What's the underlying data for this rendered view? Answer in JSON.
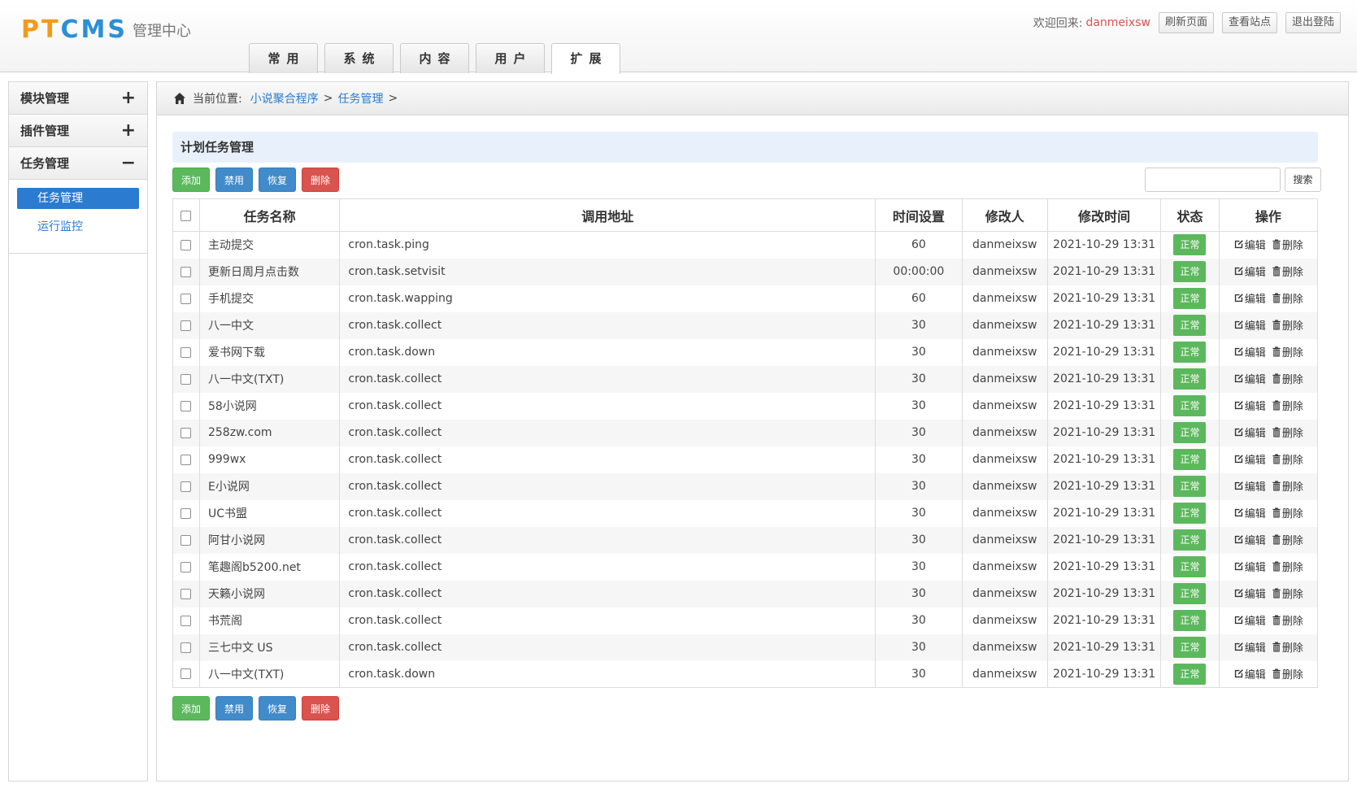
{
  "header": {
    "logo_text": "PTCMS",
    "logo_sub": "管理中心",
    "welcome": "欢迎回来:",
    "username": "danmeixsw",
    "buttons": [
      "刷新页面",
      "查看站点",
      "退出登陆"
    ],
    "tabs": [
      "常用",
      "系统",
      "内容",
      "用户",
      "扩展"
    ],
    "active_tab": "扩展"
  },
  "sidebar": {
    "groups": [
      {
        "label": "模块管理",
        "symbol": "+"
      },
      {
        "label": "插件管理",
        "symbol": "+"
      },
      {
        "label": "任务管理",
        "symbol": "−"
      }
    ],
    "items": [
      {
        "label": "任务管理",
        "active": true
      },
      {
        "label": "运行监控",
        "active": false
      }
    ]
  },
  "breadcrumb": {
    "prefix": "当前位置:",
    "links": [
      "小说聚合程序",
      "任务管理"
    ],
    "separator": ">"
  },
  "panel_title": "计划任务管理",
  "actions": {
    "add": "添加",
    "disable": "禁用",
    "restore": "恢复",
    "delete": "删除"
  },
  "search": {
    "button": "搜索",
    "placeholder": ""
  },
  "table": {
    "headers": [
      "任务名称",
      "调用地址",
      "时间设置",
      "修改人",
      "修改时间",
      "状态",
      "操作"
    ],
    "edit_label": "编辑",
    "delete_label": "删除",
    "rows": [
      {
        "name": "主动提交",
        "url": "cron.task.ping",
        "time": "60",
        "user": "danmeixsw",
        "date": "2021-10-29 13:31",
        "status": "正常"
      },
      {
        "name": "更新日周月点击数",
        "url": "cron.task.setvisit",
        "time": "00:00:00",
        "user": "danmeixsw",
        "date": "2021-10-29 13:31",
        "status": "正常"
      },
      {
        "name": "手机提交",
        "url": "cron.task.wapping",
        "time": "60",
        "user": "danmeixsw",
        "date": "2021-10-29 13:31",
        "status": "正常"
      },
      {
        "name": "八一中文",
        "url": "cron.task.collect",
        "time": "30",
        "user": "danmeixsw",
        "date": "2021-10-29 13:31",
        "status": "正常"
      },
      {
        "name": "爱书网下载",
        "url": "cron.task.down",
        "time": "30",
        "user": "danmeixsw",
        "date": "2021-10-29 13:31",
        "status": "正常"
      },
      {
        "name": "八一中文(TXT)",
        "url": "cron.task.collect",
        "time": "30",
        "user": "danmeixsw",
        "date": "2021-10-29 13:31",
        "status": "正常"
      },
      {
        "name": "58小说网",
        "url": "cron.task.collect",
        "time": "30",
        "user": "danmeixsw",
        "date": "2021-10-29 13:31",
        "status": "正常"
      },
      {
        "name": "258zw.com",
        "url": "cron.task.collect",
        "time": "30",
        "user": "danmeixsw",
        "date": "2021-10-29 13:31",
        "status": "正常"
      },
      {
        "name": "999wx",
        "url": "cron.task.collect",
        "time": "30",
        "user": "danmeixsw",
        "date": "2021-10-29 13:31",
        "status": "正常"
      },
      {
        "name": "E小说网",
        "url": "cron.task.collect",
        "time": "30",
        "user": "danmeixsw",
        "date": "2021-10-29 13:31",
        "status": "正常"
      },
      {
        "name": "UC书盟",
        "url": "cron.task.collect",
        "time": "30",
        "user": "danmeixsw",
        "date": "2021-10-29 13:31",
        "status": "正常"
      },
      {
        "name": "阿甘小说网",
        "url": "cron.task.collect",
        "time": "30",
        "user": "danmeixsw",
        "date": "2021-10-29 13:31",
        "status": "正常"
      },
      {
        "name": "笔趣阁b5200.net",
        "url": "cron.task.collect",
        "time": "30",
        "user": "danmeixsw",
        "date": "2021-10-29 13:31",
        "status": "正常"
      },
      {
        "name": "天籁小说网",
        "url": "cron.task.collect",
        "time": "30",
        "user": "danmeixsw",
        "date": "2021-10-29 13:31",
        "status": "正常"
      },
      {
        "name": "书荒阁",
        "url": "cron.task.collect",
        "time": "30",
        "user": "danmeixsw",
        "date": "2021-10-29 13:31",
        "status": "正常"
      },
      {
        "name": "三七中文 US",
        "url": "cron.task.collect",
        "time": "30",
        "user": "danmeixsw",
        "date": "2021-10-29 13:31",
        "status": "正常"
      },
      {
        "name": "八一中文(TXT)",
        "url": "cron.task.down",
        "time": "30",
        "user": "danmeixsw",
        "date": "2021-10-29 13:31",
        "status": "正常"
      }
    ]
  },
  "colors": {
    "brand_orange": "#f39a1a",
    "brand_blue": "#2b8fd6",
    "success": "#5cb85c",
    "primary": "#428bca",
    "danger": "#d9534f",
    "link": "#2b7bd0"
  }
}
